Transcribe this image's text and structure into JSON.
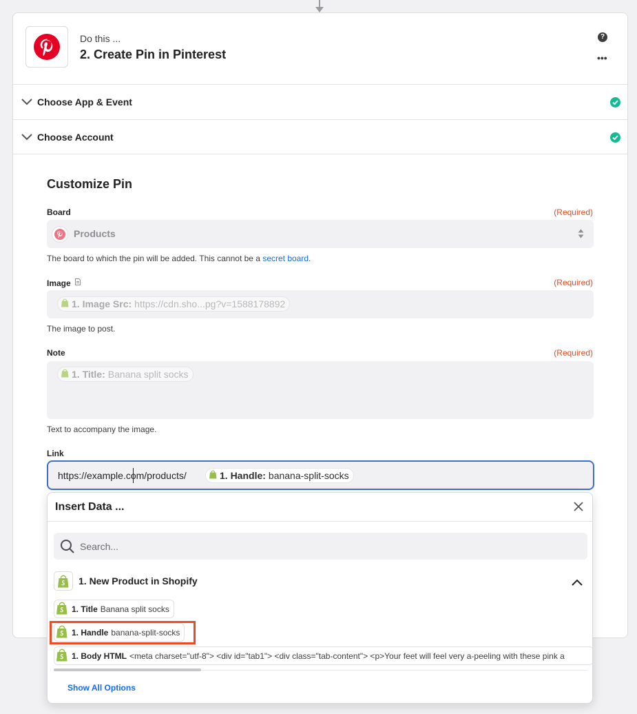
{
  "step": {
    "prefix": "Do this ...",
    "title": "2. Create Pin in Pinterest",
    "help_glyph": "?",
    "more_glyph": "•••"
  },
  "sections": [
    {
      "label": "Choose App & Event",
      "status": "complete"
    },
    {
      "label": "Choose Account",
      "status": "complete"
    }
  ],
  "form": {
    "title": "Customize Pin",
    "board": {
      "label": "Board",
      "required": "(Required)",
      "value": "Products",
      "help_prefix": "The board to which the pin will be added. This cannot be a ",
      "help_link": "secret board",
      "help_suffix": "."
    },
    "image": {
      "label": "Image",
      "required": "(Required)",
      "pill_key": "1. Image Src:",
      "pill_value": "https://cdn.sho...pg?v=1588178892",
      "help": "The image to post."
    },
    "note": {
      "label": "Note",
      "required": "(Required)",
      "pill_key": "1. Title:",
      "pill_value": "Banana split socks",
      "help": "Text to accompany the image."
    },
    "link": {
      "label": "Link",
      "typed_value": "https://example.com/products/",
      "pill_key": "1. Handle:",
      "pill_value": "banana-split-socks"
    }
  },
  "insert_data": {
    "title": "Insert Data ...",
    "search_placeholder": "Search...",
    "group_title": "1. New Product in Shopify",
    "options": [
      {
        "key": "1. Title",
        "value": "Banana split socks"
      },
      {
        "key": "1. Handle",
        "value": "banana-split-socks",
        "highlighted": true
      },
      {
        "key": "1. Body HTML",
        "value": "<meta charset=\"utf-8\"> <div id=\"tab1\"> <div class=\"tab-content\"> <p>Your feet will feel very a-peeling with these pink a"
      }
    ],
    "show_all": "Show All Options"
  },
  "colors": {
    "pinterest": "#e60023",
    "shopify": "#95bf47",
    "success": "#13bb92",
    "required": "#e64a1d",
    "link": "#136bf5",
    "focus": "#3d6fc4",
    "highlight": "#ef4a23"
  },
  "icons": [
    "pinterest-logo-icon",
    "help-icon",
    "more-icon",
    "chevron-down-icon",
    "check-circle-icon",
    "shopify-bag-icon",
    "close-icon",
    "search-icon",
    "chevron-up-icon",
    "select-arrows-icon",
    "document-icon"
  ]
}
